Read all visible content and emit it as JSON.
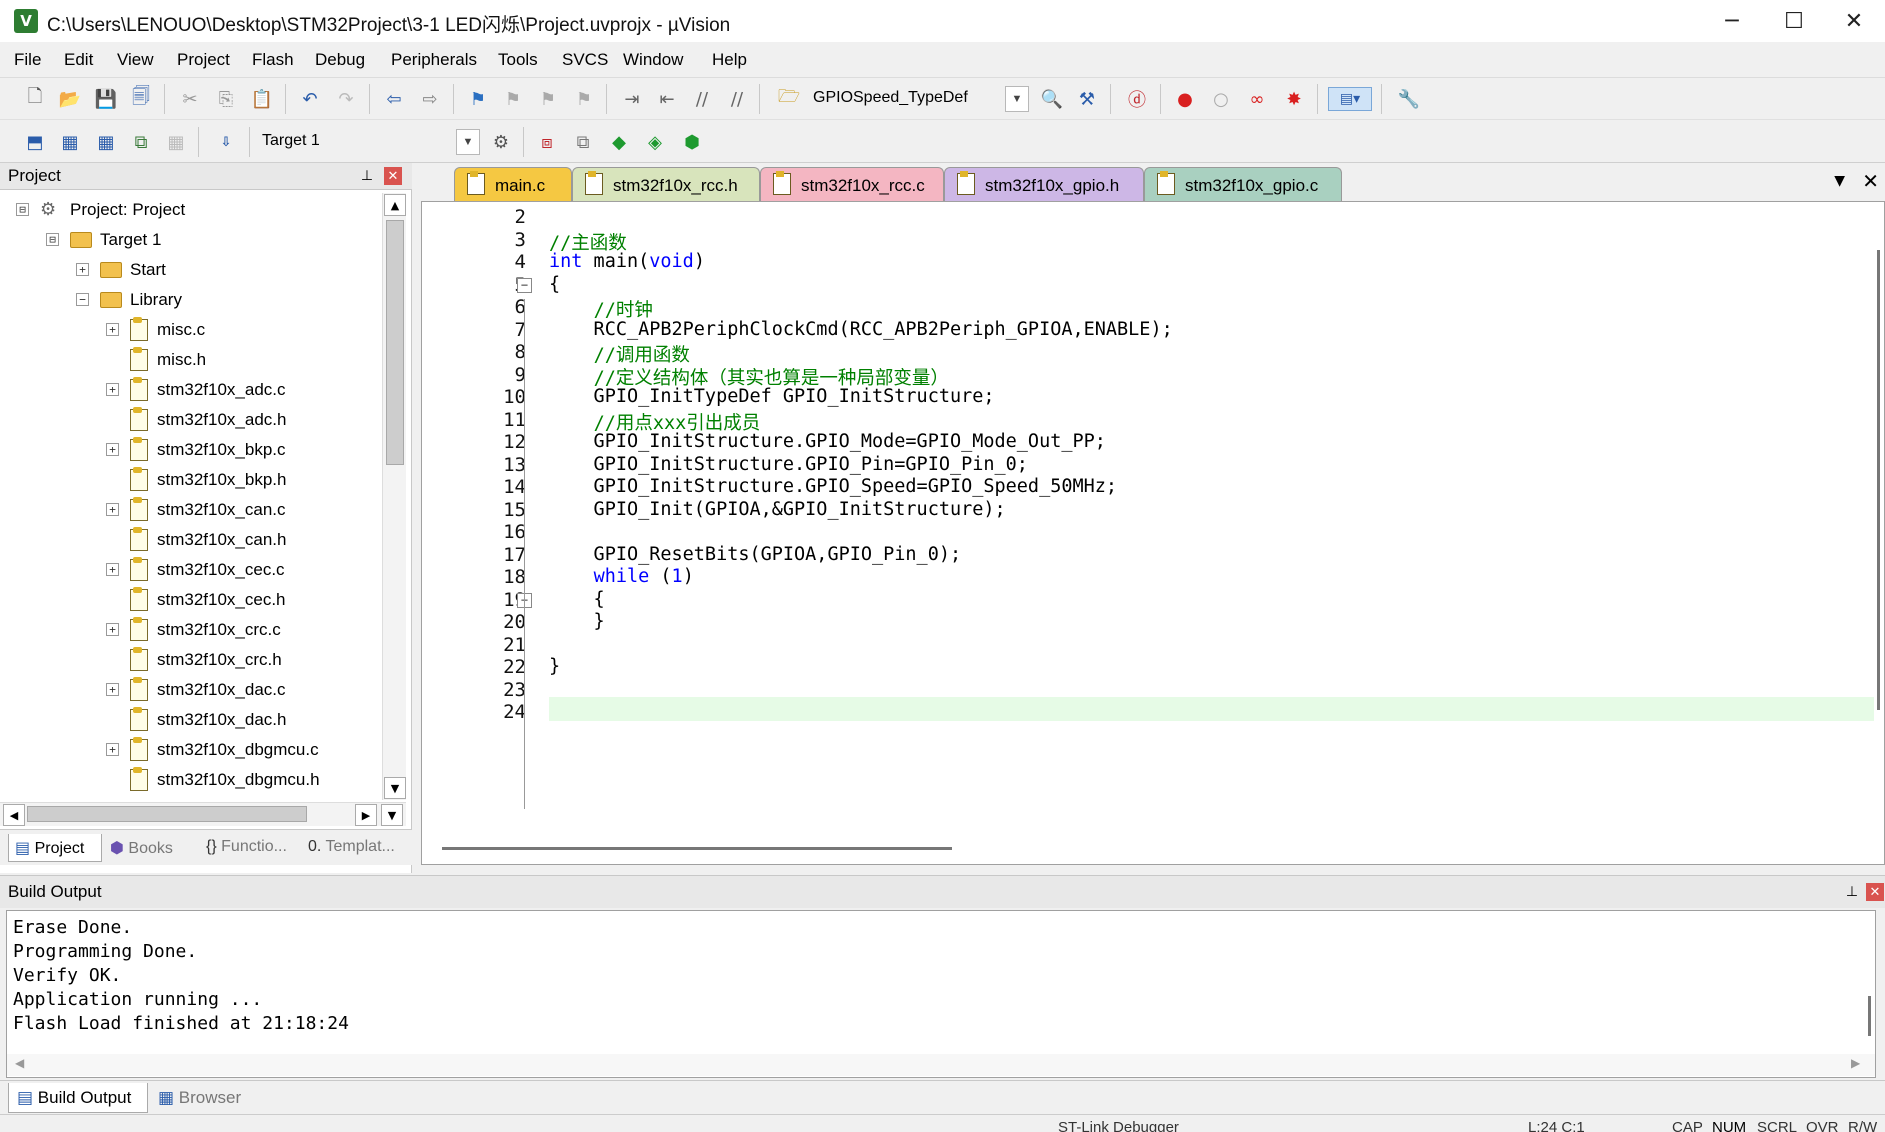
{
  "window": {
    "title": "C:\\Users\\LENOUO\\Desktop\\STM32Project\\3-1 LED闪烁\\Project.uvprojx - µVision",
    "minimize": "─",
    "maximize": "☐",
    "close": "✕"
  },
  "menu": [
    "File",
    "Edit",
    "View",
    "Project",
    "Flash",
    "Debug",
    "Peripherals",
    "Tools",
    "SVCS",
    "Window",
    "Help"
  ],
  "toolbar": {
    "find_combo": "GPIOSpeed_TypeDef",
    "target_combo": "Target 1"
  },
  "project_panel": {
    "title": "Project",
    "pin": "📌",
    "close": "✕",
    "tree": [
      {
        "label": "Project: Project",
        "level": 0,
        "icon": "project-icon",
        "expander": "⊟"
      },
      {
        "label": "Target 1",
        "level": 1,
        "icon": "folder-icon",
        "expander": "⊟"
      },
      {
        "label": "Start",
        "level": 2,
        "icon": "folder-icon",
        "expander": "+"
      },
      {
        "label": "Library",
        "level": 2,
        "icon": "folder-icon",
        "expander": "−"
      },
      {
        "label": "misc.c",
        "level": 3,
        "icon": "file-icon",
        "expander": "+"
      },
      {
        "label": "misc.h",
        "level": 3,
        "icon": "file-icon",
        "expander": ""
      },
      {
        "label": "stm32f10x_adc.c",
        "level": 3,
        "icon": "file-icon",
        "expander": "+"
      },
      {
        "label": "stm32f10x_adc.h",
        "level": 3,
        "icon": "file-icon",
        "expander": ""
      },
      {
        "label": "stm32f10x_bkp.c",
        "level": 3,
        "icon": "file-icon",
        "expander": "+"
      },
      {
        "label": "stm32f10x_bkp.h",
        "level": 3,
        "icon": "file-icon",
        "expander": ""
      },
      {
        "label": "stm32f10x_can.c",
        "level": 3,
        "icon": "file-icon",
        "expander": "+"
      },
      {
        "label": "stm32f10x_can.h",
        "level": 3,
        "icon": "file-icon",
        "expander": ""
      },
      {
        "label": "stm32f10x_cec.c",
        "level": 3,
        "icon": "file-icon",
        "expander": "+"
      },
      {
        "label": "stm32f10x_cec.h",
        "level": 3,
        "icon": "file-icon",
        "expander": ""
      },
      {
        "label": "stm32f10x_crc.c",
        "level": 3,
        "icon": "file-icon",
        "expander": "+"
      },
      {
        "label": "stm32f10x_crc.h",
        "level": 3,
        "icon": "file-icon",
        "expander": ""
      },
      {
        "label": "stm32f10x_dac.c",
        "level": 3,
        "icon": "file-icon",
        "expander": "+"
      },
      {
        "label": "stm32f10x_dac.h",
        "level": 3,
        "icon": "file-icon",
        "expander": ""
      },
      {
        "label": "stm32f10x_dbgmcu.c",
        "level": 3,
        "icon": "file-icon",
        "expander": "+"
      },
      {
        "label": "stm32f10x_dbgmcu.h",
        "level": 3,
        "icon": "file-icon",
        "expander": ""
      }
    ],
    "tabs": [
      "Project",
      "Books",
      "Functio...",
      "Templat..."
    ]
  },
  "editor": {
    "tabs": [
      {
        "label": "main.c",
        "color": "#f5c842",
        "active": true
      },
      {
        "label": "stm32f10x_rcc.h",
        "color": "#d8e4bc"
      },
      {
        "label": "stm32f10x_rcc.c",
        "color": "#f4b6c2"
      },
      {
        "label": "stm32f10x_gpio.h",
        "color": "#cdb7e6"
      },
      {
        "label": "stm32f10x_gpio.c",
        "color": "#a9d0c0"
      }
    ],
    "tabs_menu": "▼",
    "tabs_close": "✕",
    "lines": [
      {
        "n": "2",
        "fold": "",
        "parts": []
      },
      {
        "n": "3",
        "fold": "",
        "parts": [
          {
            "t": "//主函数",
            "c": "cm"
          }
        ]
      },
      {
        "n": "4",
        "fold": "",
        "parts": [
          {
            "t": "int",
            "c": "kw"
          },
          {
            "t": " main(",
            "c": ""
          },
          {
            "t": "void",
            "c": "kw"
          },
          {
            "t": ")",
            "c": ""
          }
        ]
      },
      {
        "n": "5",
        "fold": "−",
        "parts": [
          {
            "t": "{",
            "c": ""
          }
        ]
      },
      {
        "n": "6",
        "fold": "",
        "parts": [
          {
            "t": "    ",
            "c": ""
          },
          {
            "t": "//时钟",
            "c": "cm"
          }
        ]
      },
      {
        "n": "7",
        "fold": "",
        "parts": [
          {
            "t": "    RCC_APB2PeriphClockCmd(RCC_APB2Periph_GPIOA,ENABLE);",
            "c": ""
          }
        ]
      },
      {
        "n": "8",
        "fold": "",
        "parts": [
          {
            "t": "    ",
            "c": ""
          },
          {
            "t": "//调用函数",
            "c": "cm"
          }
        ]
      },
      {
        "n": "9",
        "fold": "",
        "parts": [
          {
            "t": "    ",
            "c": ""
          },
          {
            "t": "//定义结构体（其实也算是一种局部变量）",
            "c": "cm"
          }
        ]
      },
      {
        "n": "10",
        "fold": "",
        "parts": [
          {
            "t": "    GPIO_InitTypeDef GPIO_InitStructure;",
            "c": ""
          }
        ]
      },
      {
        "n": "11",
        "fold": "",
        "parts": [
          {
            "t": "    ",
            "c": ""
          },
          {
            "t": "//用点xxx引出成员",
            "c": "cm"
          }
        ]
      },
      {
        "n": "12",
        "fold": "",
        "parts": [
          {
            "t": "    GPIO_InitStructure.GPIO_Mode=GPIO_Mode_Out_PP;",
            "c": ""
          }
        ]
      },
      {
        "n": "13",
        "fold": "",
        "parts": [
          {
            "t": "    GPIO_InitStructure.GPIO_Pin=GPIO_Pin_0;",
            "c": ""
          }
        ]
      },
      {
        "n": "14",
        "fold": "",
        "parts": [
          {
            "t": "    GPIO_InitStructure.GPIO_Speed=GPIO_Speed_50MHz;",
            "c": ""
          }
        ]
      },
      {
        "n": "15",
        "fold": "",
        "parts": [
          {
            "t": "    GPIO_Init(GPIOA,&GPIO_InitStructure);",
            "c": ""
          }
        ]
      },
      {
        "n": "16",
        "fold": "",
        "parts": []
      },
      {
        "n": "17",
        "fold": "",
        "parts": [
          {
            "t": "    GPIO_ResetBits(GPIOA,GPIO_Pin_0);",
            "c": ""
          }
        ]
      },
      {
        "n": "18",
        "fold": "",
        "parts": [
          {
            "t": "    ",
            "c": ""
          },
          {
            "t": "while",
            "c": "kw"
          },
          {
            "t": " (",
            "c": ""
          },
          {
            "t": "1",
            "c": "num"
          },
          {
            "t": ")",
            "c": ""
          }
        ]
      },
      {
        "n": "19",
        "fold": "−",
        "parts": [
          {
            "t": "    {",
            "c": ""
          }
        ]
      },
      {
        "n": "20",
        "fold": "",
        "parts": [
          {
            "t": "    }",
            "c": ""
          }
        ]
      },
      {
        "n": "21",
        "fold": "",
        "parts": []
      },
      {
        "n": "22",
        "fold": "",
        "parts": [
          {
            "t": "}",
            "c": ""
          }
        ]
      },
      {
        "n": "23",
        "fold": "",
        "parts": []
      },
      {
        "n": "24",
        "fold": "",
        "parts": []
      }
    ]
  },
  "build_output": {
    "title": "Build Output",
    "lines": [
      "Erase Done.",
      "Programming Done.",
      "Verify OK.",
      "Application running ...",
      "Flash Load finished at 21:18:24"
    ],
    "tabs": [
      "Build Output",
      "Browser"
    ]
  },
  "statusbar": {
    "debugger": "ST-Link Debugger",
    "position": "L:24 C:1",
    "caps": "CAP",
    "num": "NUM",
    "scrl": "SCRL",
    "ovr": "OVR",
    "rw": "R/W"
  }
}
